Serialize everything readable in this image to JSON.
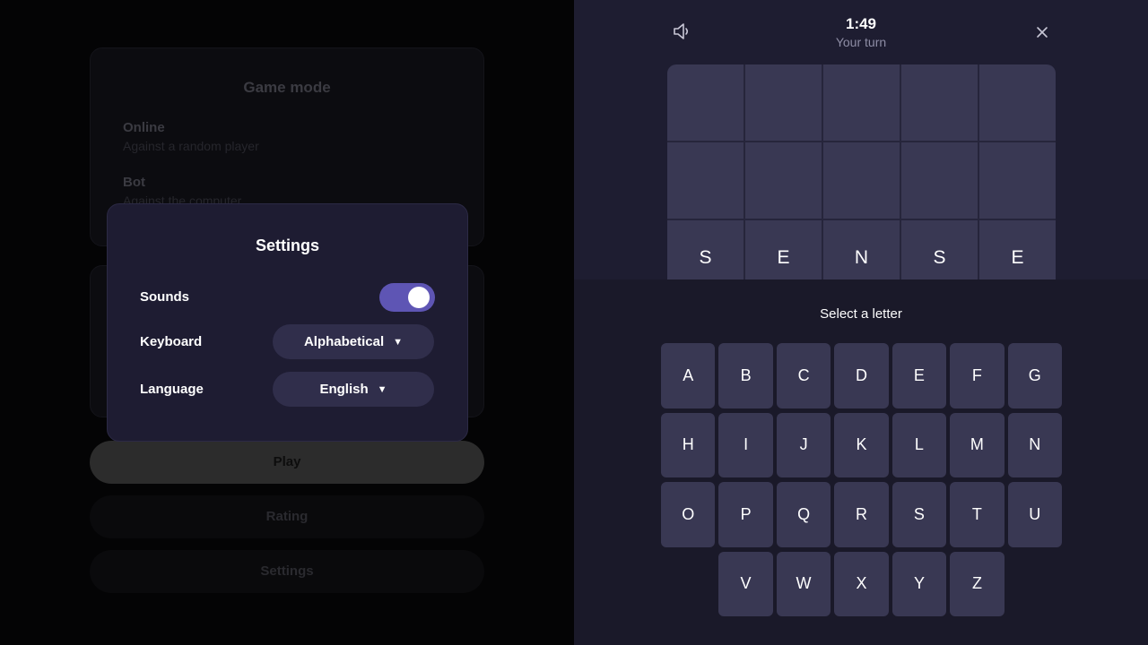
{
  "menu": {
    "game_mode_title": "Game mode",
    "options": [
      {
        "title": "Online",
        "subtitle": "Against a random player"
      },
      {
        "title": "Bot",
        "subtitle": "Against the computer"
      }
    ],
    "play_label": "Play",
    "rating_label": "Rating",
    "settings_label": "Settings"
  },
  "settings_dialog": {
    "title": "Settings",
    "sounds_label": "Sounds",
    "sounds_on": true,
    "keyboard_label": "Keyboard",
    "keyboard_value": "Alphabetical",
    "language_label": "Language",
    "language_value": "English",
    "caret": "▼"
  },
  "game": {
    "timer": "1:49",
    "turn_status": "Your turn",
    "sound_icon": "speaker-icon",
    "close_icon": "close-icon",
    "board_rows": [
      [
        "",
        "",
        "",
        "",
        ""
      ],
      [
        "",
        "",
        "",
        "",
        ""
      ],
      [
        "S",
        "E",
        "N",
        "S",
        "E"
      ]
    ],
    "select_prompt": "Select a letter",
    "keyboard_rows": [
      [
        "A",
        "B",
        "C",
        "D",
        "E",
        "F",
        "G"
      ],
      [
        "H",
        "I",
        "J",
        "K",
        "L",
        "M",
        "N"
      ],
      [
        "O",
        "P",
        "Q",
        "R",
        "S",
        "T",
        "U"
      ],
      [
        "V",
        "W",
        "X",
        "Y",
        "Z"
      ]
    ]
  },
  "colors": {
    "accent": "#5e55b4",
    "dialog_bg": "#1e1c32",
    "tile_bg": "#393853"
  }
}
